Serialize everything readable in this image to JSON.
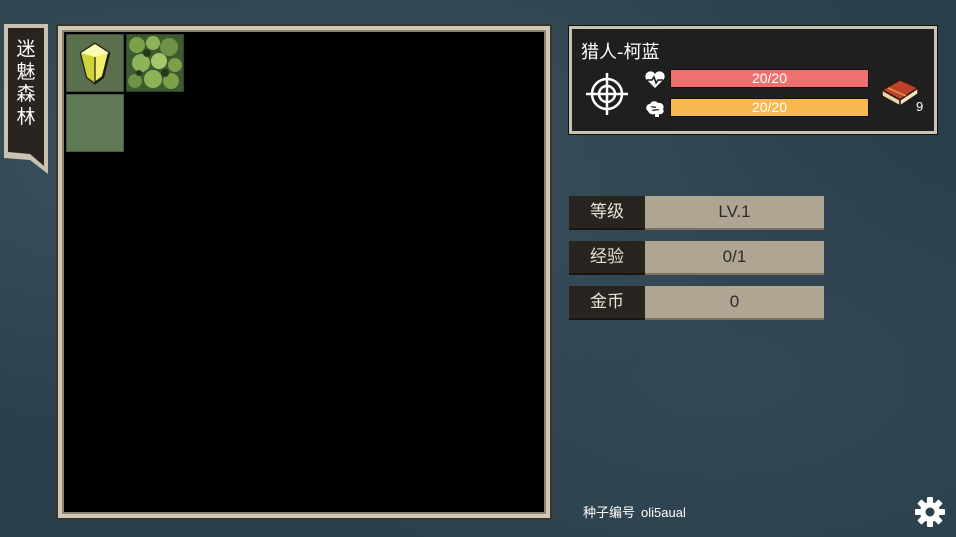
{
  "area": {
    "name": "迷魅森林"
  },
  "map": {
    "tiles": [
      {
        "type": "crystal",
        "icon": "crystal-icon"
      },
      {
        "type": "forest",
        "icon": "forest-icon"
      },
      {
        "type": "grass",
        "icon": "grass-icon"
      }
    ]
  },
  "character": {
    "name": "猎人-柯蓝",
    "class_icon": "crosshair-icon",
    "hp": {
      "icon": "heart-icon",
      "text": "20/20",
      "color": "#f07070"
    },
    "sp": {
      "icon": "brain-icon",
      "text": "20/20",
      "color": "#f8b850"
    },
    "inventory": {
      "icon": "book-icon",
      "count": "9"
    }
  },
  "stats": {
    "level": {
      "label": "等级",
      "value": "LV.1"
    },
    "exp": {
      "label": "经验",
      "value": "0/1"
    },
    "gold": {
      "label": "金币",
      "value": "0"
    }
  },
  "footer": {
    "seed_label": "种子编号",
    "seed_value": "oli5aual",
    "settings_icon": "gear-icon"
  }
}
